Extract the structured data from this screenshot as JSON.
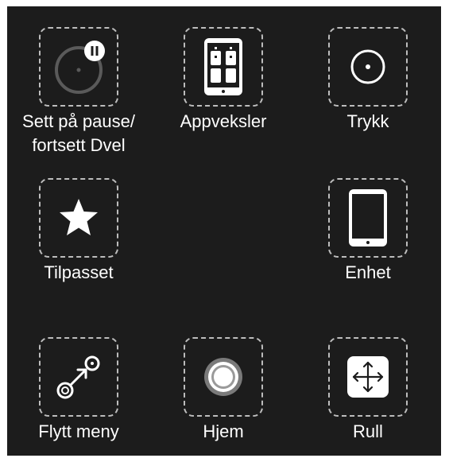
{
  "menu": {
    "items": [
      {
        "label_line1": "Sett på pause/",
        "label_line2": "fortsett Dvel",
        "icon": "pause-dwell-icon"
      },
      {
        "label_line1": "Appveksler",
        "icon": "app-switcher-icon"
      },
      {
        "label_line1": "Trykk",
        "icon": "tap-icon"
      },
      {
        "label_line1": "Tilpasset",
        "icon": "star-icon"
      },
      {
        "label_line1": "Enhet",
        "icon": "ipad-device-icon"
      },
      {
        "label_line1": "Flytt meny",
        "icon": "move-menu-icon"
      },
      {
        "label_line1": "Hjem",
        "icon": "home-button-icon"
      },
      {
        "label_line1": "Rull",
        "icon": "scroll-arrows-icon"
      }
    ]
  },
  "colors": {
    "background": "#1c1c1c",
    "dashed_border": "#bdbdbd",
    "text": "#ffffff"
  }
}
